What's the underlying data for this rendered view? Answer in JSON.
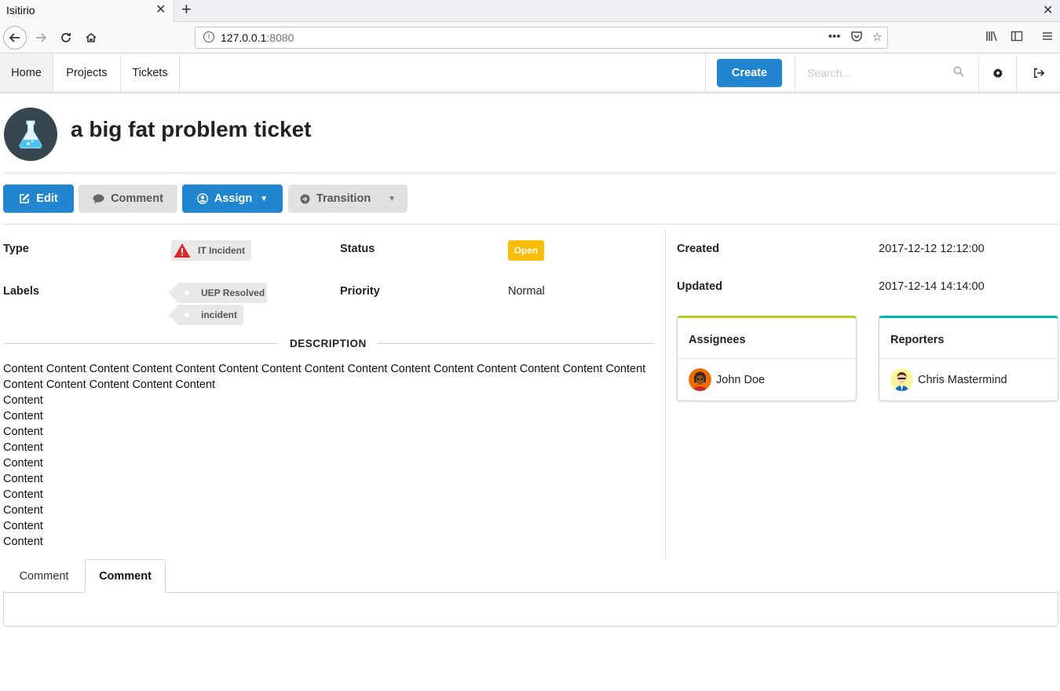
{
  "browser": {
    "tab_title": "Isitirio",
    "url_host": "127.0.0.1",
    "url_port": ":8080"
  },
  "nav": {
    "home": "Home",
    "projects": "Projects",
    "tickets": "Tickets",
    "create": "Create",
    "search_placeholder": "Search..."
  },
  "ticket": {
    "title": "a big fat problem ticket",
    "actions": {
      "edit": "Edit",
      "comment": "Comment",
      "assign": "Assign",
      "transition": "Transition"
    },
    "fields": {
      "type_label": "Type",
      "type_value": "IT Incident",
      "status_label": "Status",
      "status_value": "Open",
      "labels_label": "Labels",
      "labels": [
        "UEP Resolved",
        "incident"
      ],
      "priority_label": "Priority",
      "priority_value": "Normal",
      "created_label": "Created",
      "created_value": "2017-12-12 12:12:00",
      "updated_label": "Updated",
      "updated_value": "2017-12-14 14:14:00"
    },
    "description_heading": "DESCRIPTION",
    "description_lines": [
      "Content Content Content Content Content Content Content Content Content Content Content Content Content Content Content Content Content Content Content Content",
      "Content",
      "Content",
      "Content",
      "Content",
      "Content",
      "Content",
      "Content",
      "Content",
      "Content",
      "Content"
    ],
    "assignees": {
      "heading": "Assignees",
      "name": "John Doe"
    },
    "reporters": {
      "heading": "Reporters",
      "name": "Chris Mastermind"
    }
  },
  "bottom_tabs": [
    "Comment",
    "Comment"
  ],
  "colors": {
    "primary": "#2185d0",
    "status_open": "#fbbd08",
    "assignees_accent": "#b5cc18",
    "reporters_accent": "#00b5ad"
  }
}
